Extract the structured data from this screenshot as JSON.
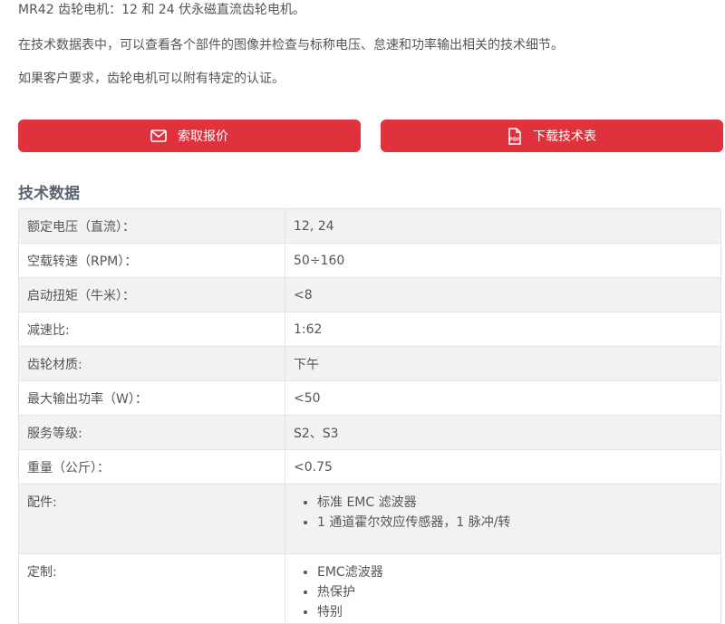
{
  "intro": {
    "line1": "MR42 齿轮电机：12 和 24 伏永磁直流齿轮电机。",
    "line2": "在技术数据表中，可以查看各个部件的图像并检查与标称电压、怠速和功率输出相关的技术细节。",
    "line3": "如果客户要求，齿轮电机可以附有特定的认证。"
  },
  "buttons": {
    "quote_label": "索取报价",
    "datasheet_label": "下载技术表",
    "pdf_badge": "PDF"
  },
  "section": {
    "title": "技术数据"
  },
  "specs": {
    "rows": [
      {
        "label": "额定电压（直流）：",
        "value": "12, 24"
      },
      {
        "label": "空载转速（RPM）：",
        "value": "50÷160"
      },
      {
        "label": "启动扭矩（牛米）：",
        "value": "<8"
      },
      {
        "label": "减速比:",
        "value": "1:62"
      },
      {
        "label": "齿轮材质:",
        "value": "下午"
      },
      {
        "label": "最大输出功率（W）：",
        "value": "<50"
      },
      {
        "label": "服务等级:",
        "value": "S2、S3"
      },
      {
        "label": "重量（公斤）：",
        "value": "<0.75"
      }
    ],
    "accessories": {
      "label": "配件:",
      "items": [
        "标准 EMC 滤波器",
        "1 通道霍尔效应传感器，1 脉冲/转"
      ]
    },
    "custom": {
      "label": "定制:",
      "items": [
        "EMC滤波器",
        "热保护",
        "特别"
      ]
    }
  },
  "colors": {
    "button_bg": "#e0323c",
    "button_text": "#ffffff",
    "row_alt_bg": "#f2f2f2",
    "border": "#e4e4e4",
    "title": "#5a6470"
  }
}
